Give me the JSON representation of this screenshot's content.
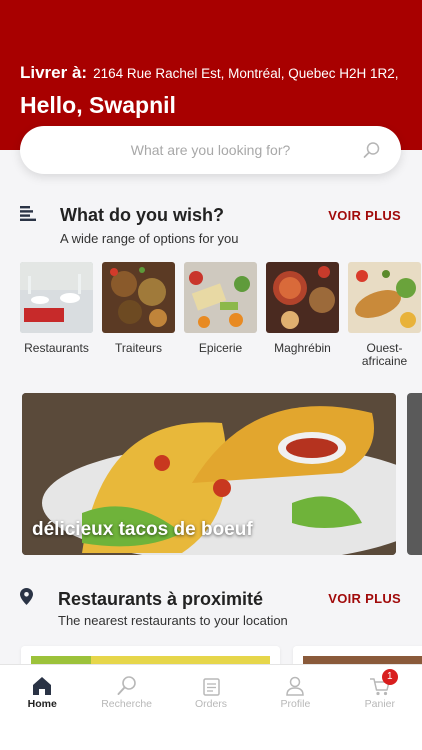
{
  "header": {
    "deliver_label": "Livrer à:",
    "address": "2164 Rue Rachel Est, Montréal, Quebec H2H 1R2,",
    "greeting": "Hello, Swapnil",
    "color": "#a80000"
  },
  "search": {
    "placeholder": "What are you looking for?"
  },
  "wish": {
    "title": "What do you wish?",
    "subtitle": "A wide range of options for you",
    "more": "VOIR PLUS",
    "categories": [
      {
        "label": "Restaurants"
      },
      {
        "label": "Traiteurs"
      },
      {
        "label": "Epicerie"
      },
      {
        "label": "Maghrébin"
      },
      {
        "label": "Ouest-africaine"
      }
    ]
  },
  "promo": {
    "caption": "délicieux tacos de boeuf"
  },
  "nearby": {
    "title": "Restaurants à proximité",
    "subtitle": "The nearest restaurants to your location",
    "more": "VOIR PLUS"
  },
  "tabbar": {
    "tabs": [
      {
        "label": "Home",
        "icon": "home-icon",
        "active": true
      },
      {
        "label": "Recherche",
        "icon": "search-icon"
      },
      {
        "label": "Orders",
        "icon": "orders-icon"
      },
      {
        "label": "Profile",
        "icon": "profile-icon"
      },
      {
        "label": "Panier",
        "icon": "cart-icon",
        "badge": "1"
      }
    ]
  },
  "colors": {
    "accent": "#a10a0a",
    "badge": "#d81e1e"
  }
}
